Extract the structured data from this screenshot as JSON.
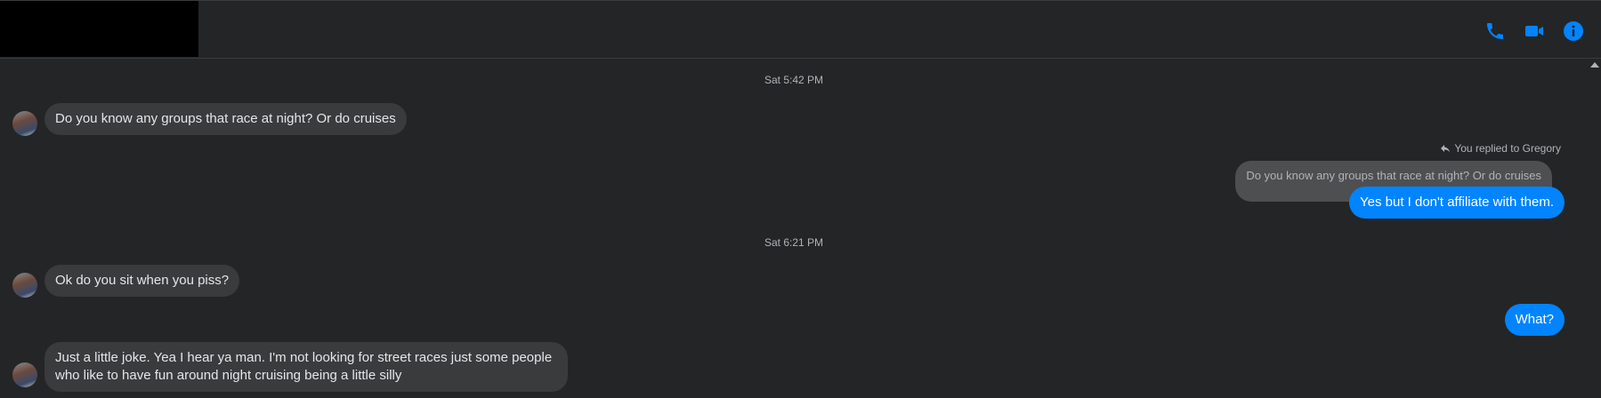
{
  "header": {
    "icons": [
      "phone-icon",
      "video-camera-icon",
      "info-icon"
    ],
    "accent": "#0084ff"
  },
  "thread": {
    "timestamp_1": "Sat 5:42 PM",
    "msg_1": "Do you know any groups that race at night? Or do cruises",
    "reply_label": "You replied to Gregory",
    "quoted": "Do you know any groups that race at night? Or do cruises",
    "reply": "Yes but I don't affiliate with them.",
    "timestamp_2": "Sat 6:21 PM",
    "msg_2": "Ok do you sit when you piss?",
    "msg_3": "What?",
    "msg_4": "Just a little joke. Yea I hear ya man. I'm not looking for street races just some people who like to have fun around night cruising being a little silly"
  },
  "colors": {
    "background": "#242526",
    "incoming_bubble": "#3a3b3c",
    "outgoing_bubble": "#0084ff",
    "quoted_bubble": "#4e4f50",
    "muted_text": "#b0b3b8"
  }
}
